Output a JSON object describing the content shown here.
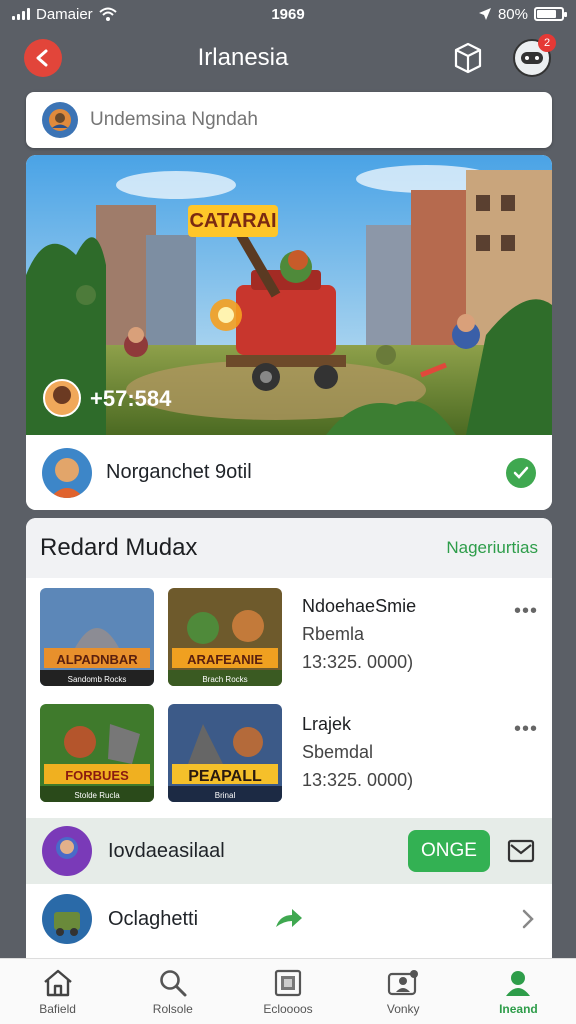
{
  "status_bar": {
    "carrier": "Damaier",
    "time": "1969",
    "battery": "80%",
    "battery_level": 0.8
  },
  "header": {
    "title": "Irlanesia",
    "notification_count": "2"
  },
  "search": {
    "placeholder": "Undemsina Ngndah"
  },
  "hero": {
    "logo_text": "CATARAI",
    "score": "+57:584",
    "game_name": "Norganchet 9otil"
  },
  "section": {
    "title": "Redard Mudax",
    "link": "Nageriurtias",
    "tiles": [
      {
        "label": "ALPADNBAR",
        "caption": "Sandomb Rocks"
      },
      {
        "label": "ARAFEANIE",
        "caption": "Brach Rocks"
      },
      {
        "label": "FORBUES",
        "caption": "Stolde Rucla"
      },
      {
        "label": "PEAPALL",
        "caption": "Brinal"
      }
    ],
    "rows": [
      {
        "title": "NdoehaeSmie",
        "sub": "Rbemla",
        "meta": "13:325. 0000)"
      },
      {
        "title": "Lrajek",
        "sub": "Sbemdal",
        "meta": "13:325. 0000)"
      }
    ]
  },
  "join": {
    "name": "Iovdaeasilaal",
    "button": "ONGE"
  },
  "next": {
    "name": "Oclaghetti"
  },
  "tabs": [
    {
      "label": "Bafield",
      "icon": "home-icon"
    },
    {
      "label": "Rolsole",
      "icon": "search-icon"
    },
    {
      "label": "Ecloooos",
      "icon": "library-icon"
    },
    {
      "label": "Vonky",
      "icon": "community-icon"
    },
    {
      "label": "Ineand",
      "icon": "profile-icon"
    }
  ],
  "colors": {
    "accent": "#33b153",
    "back": "#e2453a",
    "badge": "#e53935"
  }
}
